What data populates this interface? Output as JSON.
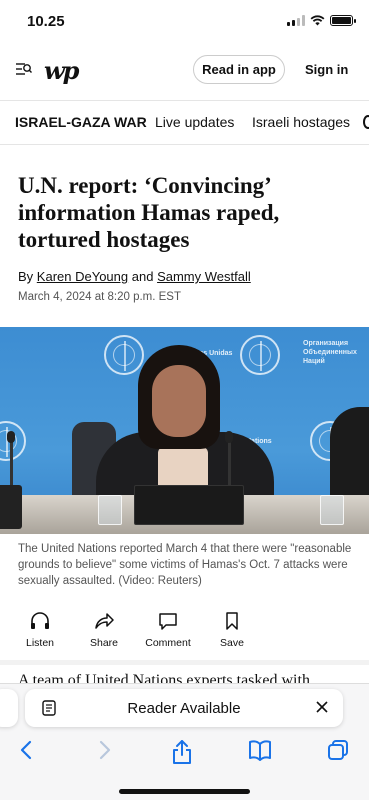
{
  "status_bar": {
    "time": "10.25"
  },
  "header": {
    "logo": "wp",
    "read_in_app": "Read in app",
    "sign_in": "Sign in"
  },
  "topics": {
    "main": "ISRAEL-GAZA WAR",
    "items": [
      "Live updates",
      "Israeli hostages"
    ]
  },
  "article": {
    "headline": "U.N. report: ‘Convincing’ information Hamas raped, tortured hostages",
    "byline_prefix": "By",
    "author1": "Karen DeYoung",
    "byline_and": "and",
    "author2": "Sammy Westfall",
    "date": "March 4, 2024 at 8:20 p.m. EST",
    "video_backdrop_text_1": "Naciones Unidas",
    "video_backdrop_text_2": "Организация Объединенных Наций",
    "video_backdrop_text_3": "Nations",
    "caption": "The United Nations reported March 4 that there were \"reasonable grounds to believe\" some victims of Hamas's Oct. 7 attacks were sexually assaulted. (Video: Reuters)",
    "body_start": "A team of United Nations experts tasked with"
  },
  "actions": {
    "listen": "Listen",
    "share": "Share",
    "comment": "Comment",
    "save": "Save"
  },
  "safari": {
    "reader_label": "Reader Available"
  }
}
